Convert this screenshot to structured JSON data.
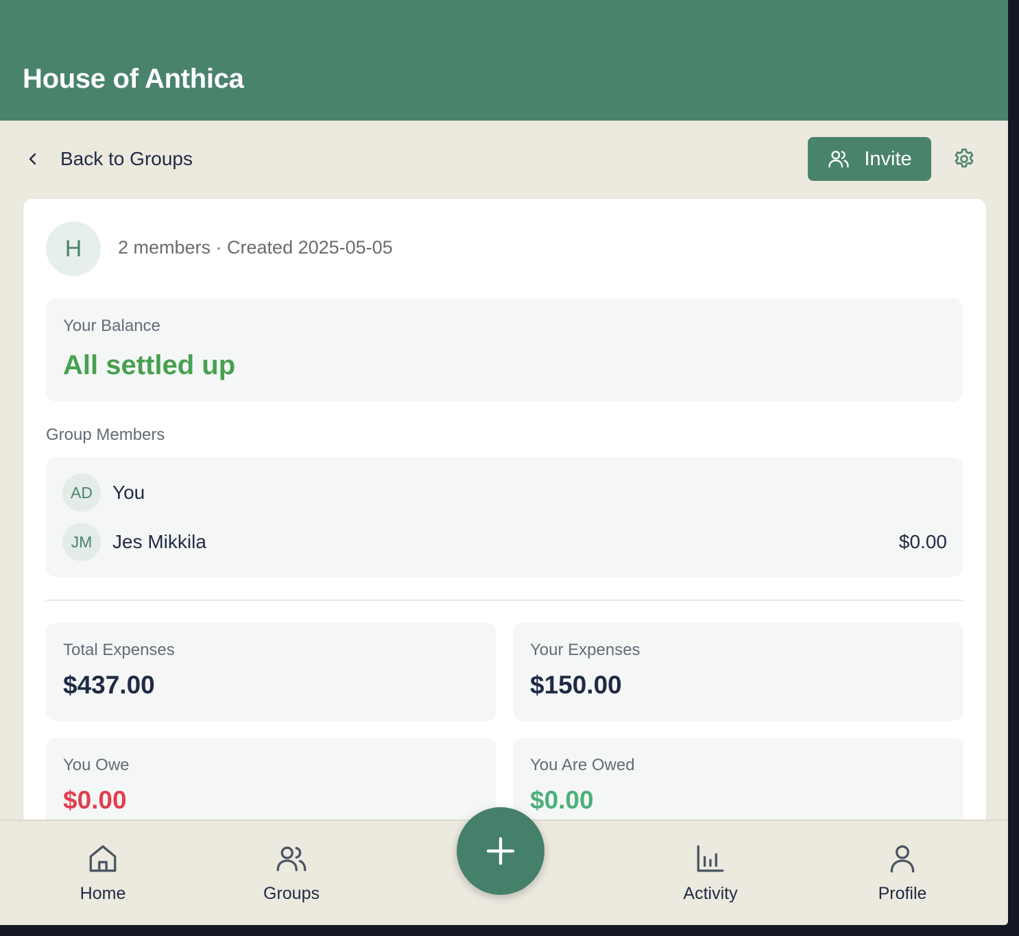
{
  "header": {
    "title": "House of Anthica"
  },
  "topbar": {
    "back_label": "Back to Groups",
    "invite_label": "Invite"
  },
  "group": {
    "avatar_letter": "H",
    "meta": "2 members · Created 2025-05-05"
  },
  "balance": {
    "label": "Your Balance",
    "value": "All settled up"
  },
  "members": {
    "label": "Group Members",
    "items": [
      {
        "initials": "AD",
        "name": "You",
        "amount": ""
      },
      {
        "initials": "JM",
        "name": "Jes Mikkila",
        "amount": "$0.00"
      }
    ]
  },
  "stats": {
    "total_expenses": {
      "label": "Total Expenses",
      "value": "$437.00"
    },
    "your_expenses": {
      "label": "Your Expenses",
      "value": "$150.00"
    },
    "you_owe": {
      "label": "You Owe",
      "value": "$0.00"
    },
    "you_are_owed": {
      "label": "You Are Owed",
      "value": "$0.00"
    }
  },
  "nav": {
    "home": "Home",
    "groups": "Groups",
    "activity": "Activity",
    "profile": "Profile"
  },
  "colors": {
    "brand": "#4a836c",
    "settled": "#47a04f",
    "owe": "#e0404f",
    "owed": "#4cb07a"
  }
}
